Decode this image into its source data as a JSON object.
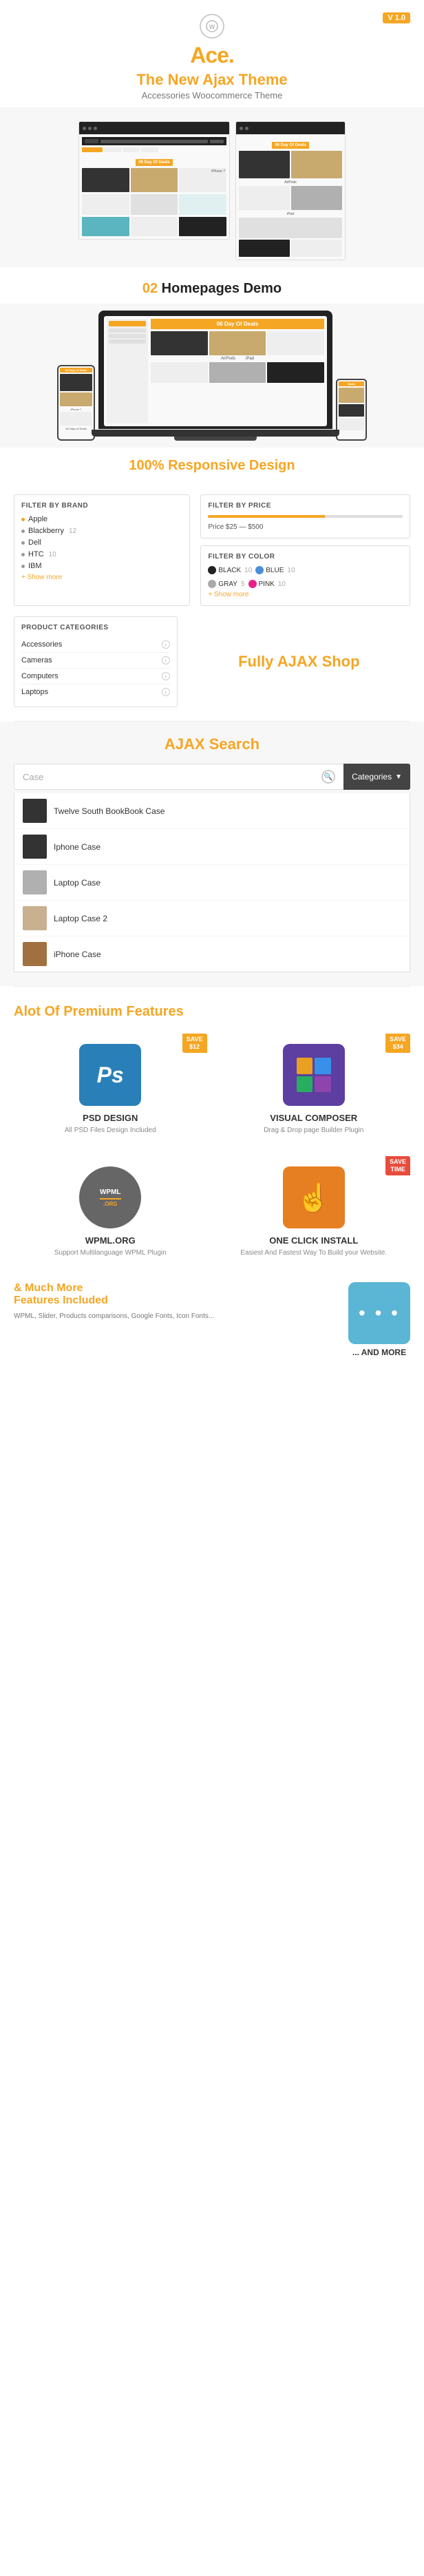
{
  "header": {
    "version": "V 1.0",
    "logo": "Ace.",
    "logo_prefix": "Ace",
    "logo_suffix": ".",
    "tagline_main": "The New Ajax Theme",
    "tagline_main_prefix": "The New ",
    "tagline_main_highlight": "Ajax",
    "tagline_main_suffix": " Theme",
    "tagline_sub": "Accessories Woocommerce Theme"
  },
  "section_homepages": {
    "label_number": "02",
    "label_text": "Homepages Demo"
  },
  "section_responsive": {
    "label_prefix": "100%",
    "label_text": " Responsive Design"
  },
  "section_ajax_shop": {
    "title_prefix": "Fully ",
    "title_highlight": "AJAX",
    "title_suffix": " Shop",
    "filters": {
      "brand_title": "FILTER BY BRAND",
      "brand_items": [
        {
          "name": "Apple",
          "count": ""
        },
        {
          "name": "Blackberry",
          "count": "12"
        },
        {
          "name": "Dell",
          "count": ""
        },
        {
          "name": "HTC",
          "count": "10"
        },
        {
          "name": "IBM",
          "count": ""
        }
      ],
      "brand_show_more": "+ Show more",
      "price_title": "FILTER BY PRICE",
      "price_range": "Price $25 — $500",
      "color_title": "FILTER BY COLOR",
      "colors": [
        {
          "name": "BLACK",
          "count": "10",
          "color": "black"
        },
        {
          "name": "GRAY",
          "count": "5",
          "color": "gray"
        },
        {
          "name": "BLUE",
          "count": "10",
          "color": "blue"
        },
        {
          "name": "PINK",
          "count": "10",
          "color": "pink"
        }
      ],
      "color_show_more": "+ Show more"
    },
    "categories": {
      "title": "PRODUCT CATEGORIES",
      "items": [
        "Accessories",
        "Cameras",
        "Computers",
        "Laptops"
      ]
    }
  },
  "section_ajax_search": {
    "title_prefix": "AJAX",
    "title_suffix": " Search",
    "search_placeholder": "Case",
    "categories_btn": "Categories",
    "results": [
      {
        "name": "Twelve South BookBook Case",
        "thumb_class": "dark"
      },
      {
        "name": "Iphone Case",
        "thumb_class": "dark"
      },
      {
        "name": "Laptop Case",
        "thumb_class": "silver"
      },
      {
        "name": "Laptop Case 2",
        "thumb_class": "beige"
      },
      {
        "name": "iPhone Case",
        "thumb_class": "wood"
      }
    ]
  },
  "section_premium": {
    "title_prefix": "Alot",
    "title_highlight": " Of Premium Features",
    "features": [
      {
        "id": "psd",
        "save_label": "SAVE\n$12",
        "icon_type": "ps",
        "icon_color": "blue",
        "name": "PSD DESIGN",
        "desc": "All PSD Files Design Included"
      },
      {
        "id": "visual_composer",
        "save_label": "SAVE\n$34",
        "icon_type": "cube",
        "icon_color": "purple",
        "name": "VISUAL COMPOSER",
        "desc": "Drag & Drop page Builder Plugin"
      },
      {
        "id": "wpml",
        "save_label": null,
        "icon_type": "wpml",
        "icon_color": "gray",
        "name": "WPML.ORG",
        "desc": "Support Multilanguage WPML Plugin"
      },
      {
        "id": "one_click",
        "save_label": "SAVE\nTIME",
        "icon_type": "click",
        "icon_color": "orange",
        "name": "ONE CLICK INSTALL",
        "desc": "Easiest And Fastest Way To Build your Website."
      }
    ]
  },
  "section_more": {
    "title_prefix": "& ",
    "title_highlight": "Much More",
    "title_suffix": " Features Included",
    "icon_type": "dots",
    "icon_color": "teal",
    "and_more_title": "... AND MORE",
    "and_more_desc": "WPML, Slider, Products comparisons, Google Fonts, Icon Fonts..."
  }
}
